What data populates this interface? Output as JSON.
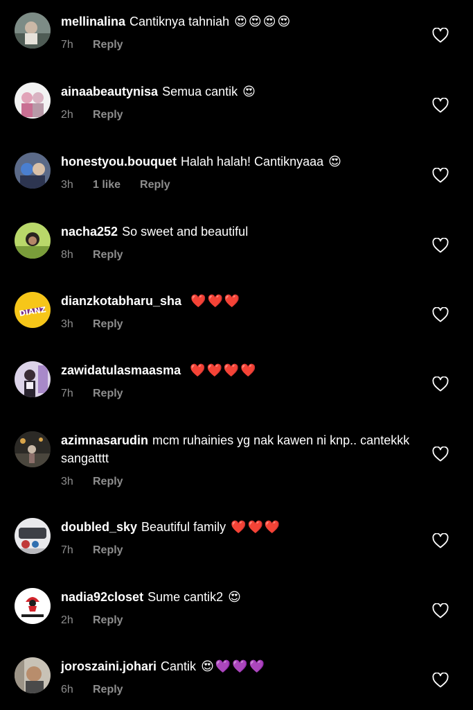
{
  "colors": {
    "background": "#000000",
    "text": "#ffffff",
    "meta": "#8e8e8e",
    "heart_outline": "#ffffff"
  },
  "icons": {
    "like": "heart-outline-icon"
  },
  "comments": [
    {
      "username": "mellinalina",
      "text": "Cantiknya tahniah",
      "emoji": "😍😍😍😍",
      "time": "7h",
      "likes": "",
      "reply": "Reply"
    },
    {
      "username": "ainaabeautynisa",
      "text": "Semua cantik",
      "emoji": "😍",
      "time": "2h",
      "likes": "",
      "reply": "Reply"
    },
    {
      "username": "honestyou.bouquet",
      "text": "Halah halah! Cantiknyaaa",
      "emoji": "😍",
      "time": "3h",
      "likes": "1 like",
      "reply": "Reply"
    },
    {
      "username": "nacha252",
      "text": "So sweet and beautiful",
      "emoji": "",
      "time": "8h",
      "likes": "",
      "reply": "Reply"
    },
    {
      "username": "dianzkotabharu_sha",
      "text": "",
      "emoji": "❤️❤️❤️",
      "time": "3h",
      "likes": "",
      "reply": "Reply"
    },
    {
      "username": "zawidatulasmaasma",
      "text": "",
      "emoji": "❤️❤️❤️❤️",
      "time": "7h",
      "likes": "",
      "reply": "Reply"
    },
    {
      "username": "azimnasarudin",
      "text": "mcm ruhainies yg nak kawen ni knp.. cantekkk sangatttt",
      "emoji": "",
      "time": "3h",
      "likes": "",
      "reply": "Reply"
    },
    {
      "username": "doubled_sky",
      "text": "Beautiful family",
      "emoji": "❤️❤️❤️",
      "time": "7h",
      "likes": "",
      "reply": "Reply"
    },
    {
      "username": "nadia92closet",
      "text": "Sume cantik2",
      "emoji": "😍",
      "time": "2h",
      "likes": "",
      "reply": "Reply"
    },
    {
      "username": "joroszaini.johari",
      "text": "Cantik",
      "emoji": "😍💜💜💜",
      "time": "6h",
      "likes": "",
      "reply": "Reply"
    }
  ]
}
